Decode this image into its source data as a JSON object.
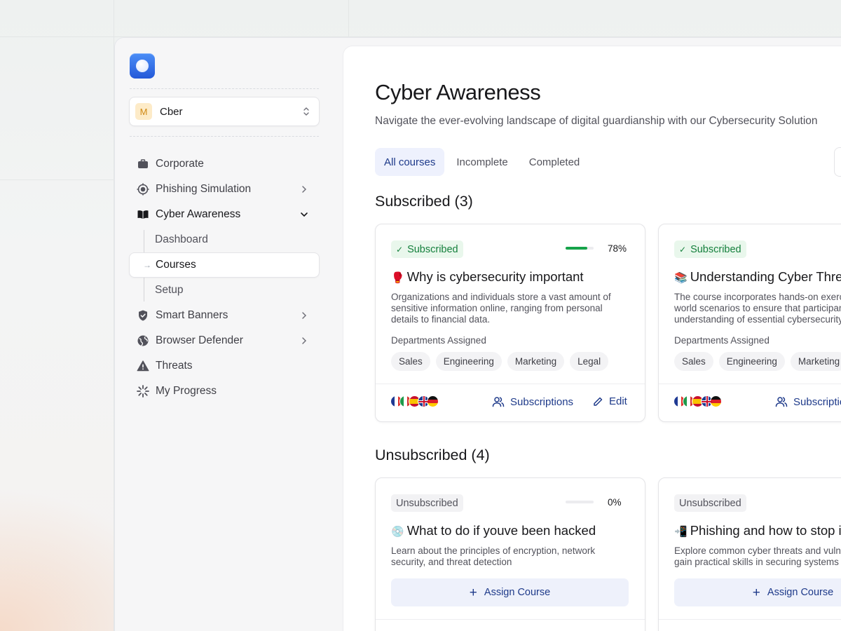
{
  "workspace": {
    "avatar_letter": "M",
    "name": "Cber"
  },
  "nav": {
    "items": [
      {
        "label": "Corporate",
        "icon": "briefcase-icon"
      },
      {
        "label": "Phishing Simulation",
        "icon": "target-icon"
      },
      {
        "label": "Cyber Awareness",
        "icon": "book-icon"
      },
      {
        "label": "Smart Banners",
        "icon": "shield-icon"
      },
      {
        "label": "Browser Defender",
        "icon": "globe-icon"
      },
      {
        "label": "Threats",
        "icon": "warning-icon"
      },
      {
        "label": "My Progress",
        "icon": "loader-icon"
      }
    ],
    "sub_items": [
      {
        "label": "Dashboard"
      },
      {
        "label": "Courses",
        "arrow": "→"
      },
      {
        "label": "Setup"
      }
    ]
  },
  "page": {
    "title": "Cyber Awareness",
    "subtitle": "Navigate the ever-evolving landscape of digital guardianship with our Cybersecurity Solution"
  },
  "tabs": [
    "All courses",
    "Incomplete",
    "Completed"
  ],
  "sections": {
    "subscribed_title": "Subscribed (3)",
    "unsubscribed_title": "Unsubscribed (4)"
  },
  "subscribed_cards": [
    {
      "badge": "Subscribed",
      "check": "✓",
      "progress": 0.78,
      "progress_label": "78%",
      "emoji": "🥊",
      "title": "Why is cybersecurity important",
      "description": "Organizations and individuals store a vast amount of sensitive information online, ranging from personal details to financial data.",
      "dept_label": "Departments Assigned",
      "departments": [
        "Sales",
        "Engineering",
        "Marketing",
        "Legal"
      ],
      "subscriptions_label": "Subscriptions",
      "edit_label": "Edit"
    },
    {
      "badge": "Subscribed",
      "check": "✓",
      "emoji": "📚",
      "title": "Understanding Cyber Threats",
      "description": "The course incorporates hands-on exercises and real-world scenarios to ensure that participants gain a solid understanding of essential cybersecurity.",
      "dept_label": "Departments Assigned",
      "departments": [
        "Sales",
        "Engineering",
        "Marketing"
      ],
      "subscriptions_label": "Subscriptions"
    }
  ],
  "unsubscribed_cards": [
    {
      "badge": "Unsubscribed",
      "progress": 0,
      "progress_label": "0%",
      "emoji": "💿",
      "title": "What to do if youve been hacked",
      "description": "Learn about the principles of encryption, network security, and threat detection",
      "button_label": "Assign Course",
      "plus": "+"
    },
    {
      "badge": "Unsubscribed",
      "emoji": "📲",
      "title": "Phishing and how to stop it",
      "description": "Explore common cyber threats and vulnerabilities, and gain practical skills in securing systems",
      "button_label": "Assign Course",
      "plus": "+"
    }
  ],
  "colors": {
    "accent": "#1e3a8a",
    "subscribed_green": "#15803d",
    "progress_green": "#16a34a",
    "logo_blue": "#2f6ae6"
  }
}
